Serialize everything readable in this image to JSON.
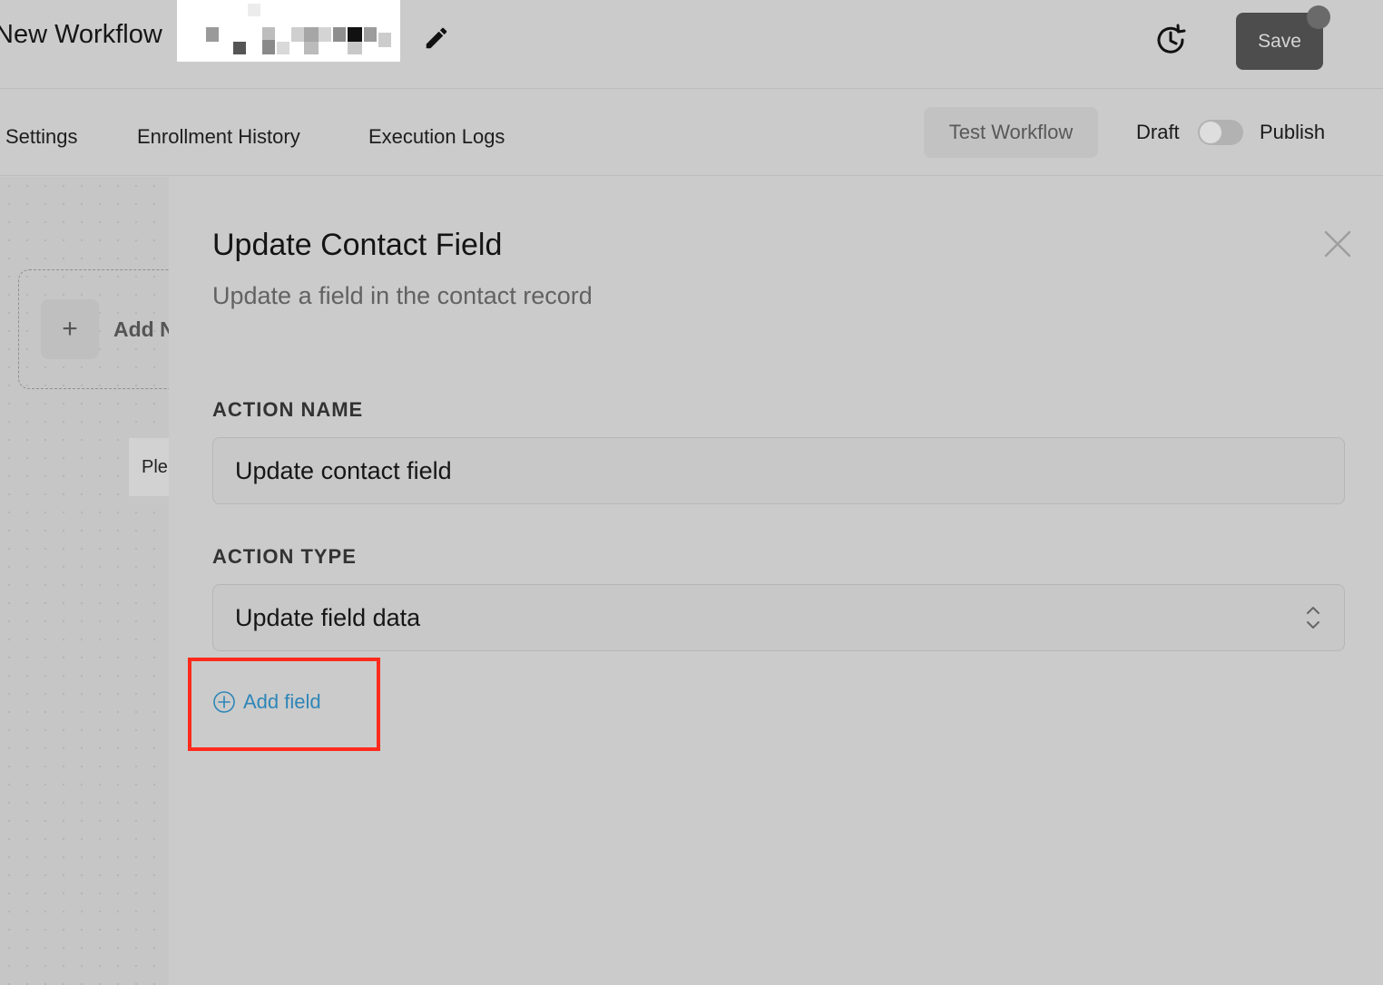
{
  "header": {
    "workflow_title": "New Workflow",
    "save_label": "Save",
    "icons": {
      "edit": "pencil-icon",
      "history": "history-icon"
    }
  },
  "tabs": {
    "items": [
      {
        "label": "Settings"
      },
      {
        "label": "Enrollment History"
      },
      {
        "label": "Execution Logs"
      }
    ],
    "test_workflow_label": "Test Workflow",
    "draft_label": "Draft",
    "publish_label": "Publish",
    "publish_toggle_on": false
  },
  "canvas": {
    "add_node_label": "Add N",
    "hint_text": "Ple"
  },
  "panel": {
    "title": "Update Contact Field",
    "subtitle": "Update a field in the contact record",
    "action_name": {
      "label": "ACTION NAME",
      "value": "Update contact field"
    },
    "action_type": {
      "label": "ACTION TYPE",
      "value": "Update field data"
    },
    "add_field_label": "Add field"
  },
  "colors": {
    "page_background": "#cbcbcb",
    "save_button": "#4d4d4d",
    "link_blue": "#2e86b8",
    "highlight_red": "#ff2a1c"
  }
}
